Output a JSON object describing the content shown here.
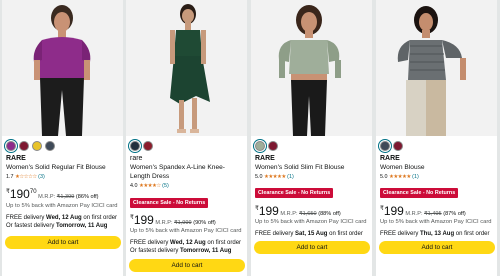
{
  "products": [
    {
      "brand": "RARE",
      "title": "Women's Solid Regular Fit Blouse",
      "rating": "1.7",
      "stars": "★☆☆☆☆",
      "rating_count": "(3)",
      "badge": "",
      "currency": "₹",
      "price": "190",
      "price_sup": "70",
      "mrp_label": "M.R.P:",
      "mrp": "₹1,399",
      "discount": "(86% off)",
      "offer": "Up to 5% back with Amazon Pay ICICI card",
      "delivery_prefix": "FREE delivery ",
      "delivery_date": "Wed, 12 Aug",
      "delivery_suffix": " on first order",
      "fast_prefix": "Or fastest delivery ",
      "fast_date": "Tomorrow, 11 Aug",
      "add_to_cart": "Add to cart",
      "swatch_colors": [
        "#8e2c8a",
        "#7d1830",
        "#e8c32a",
        "#3f4a58"
      ]
    },
    {
      "brand": "rare",
      "title": "Women's Spandex A-Line Knee-Length Dress",
      "rating": "4.0",
      "stars": "★★★★☆",
      "rating_count": "(5)",
      "badge": "Clearance Sale - No Returns",
      "currency": "₹",
      "price": "199",
      "price_sup": "",
      "mrp_label": "M.R.P:",
      "mrp": "₹1,999",
      "discount": "(90% off)",
      "offer": "Up to 5% back with Amazon Pay ICICI card",
      "delivery_prefix": "FREE delivery ",
      "delivery_date": "Wed, 12 Aug",
      "delivery_suffix": " on first order",
      "fast_prefix": "Or fastest delivery ",
      "fast_date": "Tomorrow, 11 Aug",
      "add_to_cart": "Add to cart",
      "swatch_colors": [
        "#23303d",
        "#8c1c2c"
      ]
    },
    {
      "brand": "RARE",
      "title": "Women's Solid Slim Fit Blouse",
      "rating": "5.0",
      "stars": "★★★★★",
      "rating_count": "(1)",
      "badge": "Clearance Sale - No Returns",
      "currency": "₹",
      "price": "199",
      "price_sup": "",
      "mrp_label": "M.R.P:",
      "mrp": "₹1,650",
      "discount": "(88% off)",
      "offer": "Up to 5% back with Amazon Pay ICICI card",
      "delivery_prefix": "FREE delivery ",
      "delivery_date": "Sat, 15 Aug",
      "delivery_suffix": " on first order",
      "fast_prefix": "",
      "fast_date": "",
      "add_to_cart": "Add to cart",
      "swatch_colors": [
        "#9fae9a",
        "#7d1830"
      ]
    },
    {
      "brand": "RARE",
      "title": "Women Blouse",
      "rating": "5.0",
      "stars": "★★★★★",
      "rating_count": "(1)",
      "badge": "Clearance Sale - No Returns",
      "currency": "₹",
      "price": "199",
      "price_sup": "",
      "mrp_label": "M.R.P:",
      "mrp": "₹1,495",
      "discount": "(87% off)",
      "offer": "Up to 5% back with Amazon Pay ICICI card",
      "delivery_prefix": "FREE delivery ",
      "delivery_date": "Thu, 13 Aug",
      "delivery_suffix": " on first order",
      "fast_prefix": "",
      "fast_date": "",
      "add_to_cart": "Add to cart",
      "swatch_colors": [
        "#3f4a58",
        "#7d1830"
      ]
    }
  ],
  "colors": {
    "badge": "#cc0c39",
    "star": "#de7921",
    "button": "#ffd814",
    "link": "#007185"
  }
}
